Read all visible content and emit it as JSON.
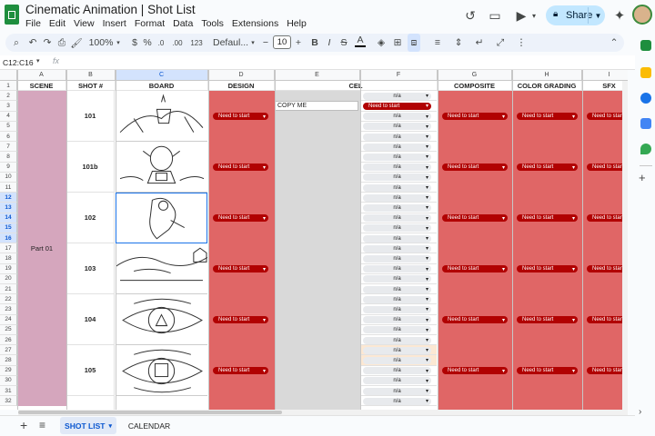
{
  "window": {
    "title": "Cinematic Animation | Shot List"
  },
  "menu": [
    "File",
    "Edit",
    "View",
    "Insert",
    "Format",
    "Data",
    "Tools",
    "Extensions",
    "Help"
  ],
  "share": {
    "label": "Share"
  },
  "toolbar": {
    "zoom": "100%",
    "currency": "$",
    "percent": "%",
    "dec_less": ".0",
    "dec_more": ".00",
    "number_format": "123",
    "font": "Defaul...",
    "font_size": "10",
    "bold": "B",
    "italic": "I",
    "strike": "S",
    "text_color": "A"
  },
  "name_box": "C12:C16",
  "fx": "fx",
  "columns": [
    "A",
    "B",
    "C",
    "D",
    "E",
    "F",
    "G",
    "H",
    "I"
  ],
  "rows": [
    "1",
    "2",
    "3",
    "4",
    "5",
    "6",
    "7",
    "8",
    "9",
    "10",
    "11",
    "12",
    "13",
    "14",
    "15",
    "16",
    "17",
    "18",
    "19",
    "20",
    "21",
    "22",
    "23",
    "24",
    "25",
    "26",
    "27",
    "28",
    "29",
    "30",
    "31",
    "32"
  ],
  "headers": {
    "scene": "SCENE",
    "shot": "SHOT #",
    "board": "BOARD",
    "design": "DESIGN",
    "cel": "CEL",
    "composite": "COMPOSITE",
    "grading": "COLOR GRADING",
    "sfx": "SFX"
  },
  "scene_label": "Part 01",
  "shots": [
    "101",
    "101b",
    "102",
    "103",
    "104",
    "105"
  ],
  "status_label": "Need to start",
  "na_label": "n/a",
  "copy_me": "COPY ME",
  "sheet_tabs": {
    "active": "SHOT LIST",
    "other": "CALENDAR"
  },
  "colors": {
    "accent": "#1a73e8",
    "status_red": "#b10202",
    "column_red": "#e06666",
    "scene_pink": "#d5a6bd",
    "sheets_green": "#1e8e3e"
  }
}
